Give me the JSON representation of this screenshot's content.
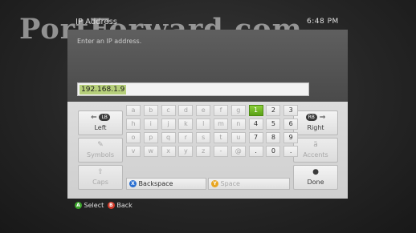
{
  "header": {
    "title": "IP Address",
    "time": "6:48  PM"
  },
  "watermark": "PortForward.com",
  "prompt": "Enter an IP address.",
  "ip_value": "192.168.1.9",
  "side_left": [
    {
      "icon": "⇐ LB",
      "label": "Left"
    },
    {
      "icon": "✎",
      "label": "Symbols"
    },
    {
      "icon": "⇧",
      "label": "Caps"
    }
  ],
  "side_right": [
    {
      "icon": "RB ⇒",
      "label": "Right"
    },
    {
      "icon": "ä",
      "label": "Accents"
    },
    {
      "icon": "●",
      "label": "Done"
    }
  ],
  "rows": [
    [
      "a",
      "b",
      "c",
      "d",
      "e",
      "f",
      "g",
      "1",
      "2",
      "3"
    ],
    [
      "h",
      "i",
      "j",
      "k",
      "l",
      "m",
      "n",
      "4",
      "5",
      "6"
    ],
    [
      "o",
      "p",
      "q",
      "r",
      "s",
      "t",
      "u",
      "7",
      "8",
      "9"
    ],
    [
      "v",
      "w",
      "x",
      "y",
      "z",
      "-",
      "@",
      ".",
      "0",
      "."
    ]
  ],
  "backspace": {
    "button": "X",
    "label": "Backspace"
  },
  "space": {
    "button": "Y",
    "label": "Space"
  },
  "legend": {
    "a_button": "A",
    "a_label": "Select",
    "b_button": "B",
    "b_label": "Back"
  },
  "colors": {
    "select_green": "#5aa017",
    "x_blue": "#2a6fd1",
    "y_yellow": "#e8a520",
    "a_green": "#3aa52a",
    "b_red": "#d23a2a"
  }
}
